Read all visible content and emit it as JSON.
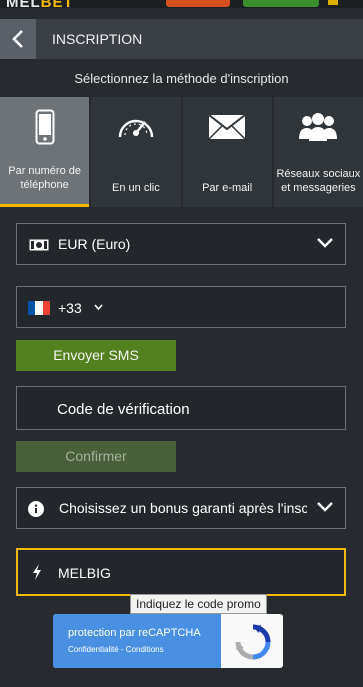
{
  "topbar": {
    "logo_a": "MEL",
    "logo_b": "BET"
  },
  "header": {
    "title": "INSCRIPTION"
  },
  "subtitle": "Sélectionnez la méthode d'inscription",
  "methods": [
    {
      "label": "Par numéro de téléphone",
      "icon": "phone-icon",
      "active": true
    },
    {
      "label": "En un clic",
      "icon": "speedometer-icon",
      "active": false
    },
    {
      "label": "Par e-mail",
      "icon": "envelope-icon",
      "active": false
    },
    {
      "label": "Réseaux sociaux et messageries",
      "icon": "people-icon",
      "active": false
    }
  ],
  "currency": {
    "value": "EUR (Euro)",
    "icon": "money-icon"
  },
  "phone": {
    "dial_code": "+33",
    "flag_colors": [
      "#0055a4",
      "#ffffff",
      "#ef4135"
    ]
  },
  "buttons": {
    "send_sms": "Envoyer SMS",
    "confirm": "Confirmer"
  },
  "verification": {
    "placeholder": "Code de vérification"
  },
  "bonus": {
    "value": "Choisissez un bonus garanti après l'inscription",
    "icon": "info-icon"
  },
  "promo": {
    "value": "MELBIG",
    "icon": "bolt-icon"
  },
  "tooltip": "Indiquez le code promo",
  "recaptcha": {
    "title": "protection par reCAPTCHA",
    "links": "Confidentialité - Conditions"
  },
  "colors": {
    "accent": "#f3b900",
    "green": "#53811f",
    "panel": "#272b2f"
  }
}
